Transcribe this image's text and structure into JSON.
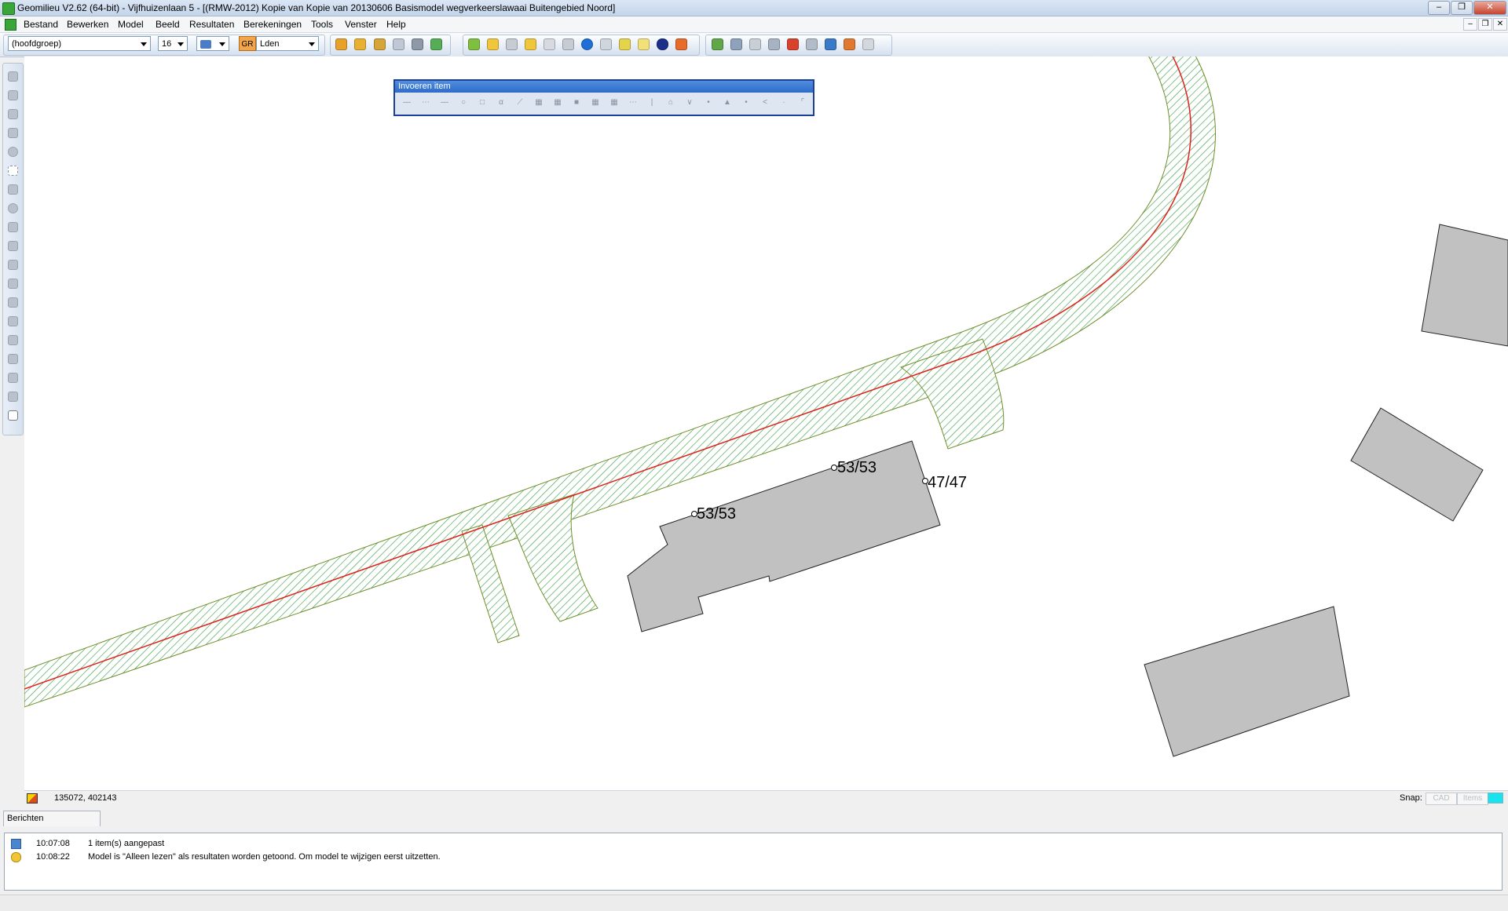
{
  "window": {
    "title": "Geomilieu V2.62 (64-bit) - Vijfhuizenlaan 5 - [(RMW-2012) Kopie van Kopie van 20130606 Basismodel wegverkeerslawaai Buitengebied Noord]"
  },
  "menu": [
    "Bestand",
    "Bewerken",
    "Model",
    "Beeld",
    "Resultaten",
    "Berekeningen",
    "Tools",
    "Venster",
    "Help"
  ],
  "toolbar": {
    "group_value": "(hoofdgroep)",
    "size_value": "16",
    "gr_badge": "GR",
    "period_value": "Lden"
  },
  "float_panel": {
    "title": "Invoeren item"
  },
  "map": {
    "labels": [
      {
        "id": "label-1",
        "text": "53/53"
      },
      {
        "id": "label-2",
        "text": "53/53"
      },
      {
        "id": "label-3",
        "text": "47/47"
      }
    ],
    "colors": {
      "road_hatch": "#3fa14a",
      "road_axis": "#e0201c",
      "building_fill": "#c1c1c1"
    }
  },
  "coordbar": {
    "coords": "135072, 402143",
    "snap_label": "Snap:",
    "snap_cad": "CAD",
    "snap_items": "Items",
    "snap_color": "#19e3ee"
  },
  "messages": {
    "tab_label": "Berichten",
    "rows": [
      {
        "time": "10:07:08",
        "text": "1 item(s) aangepast",
        "icon": "edit-icon"
      },
      {
        "time": "10:08:22",
        "text": "Model is \"Alleen lezen\" als resultaten worden getoond. Om model te wijzigen eerst uitzetten.",
        "icon": "lightbulb-icon"
      }
    ]
  }
}
